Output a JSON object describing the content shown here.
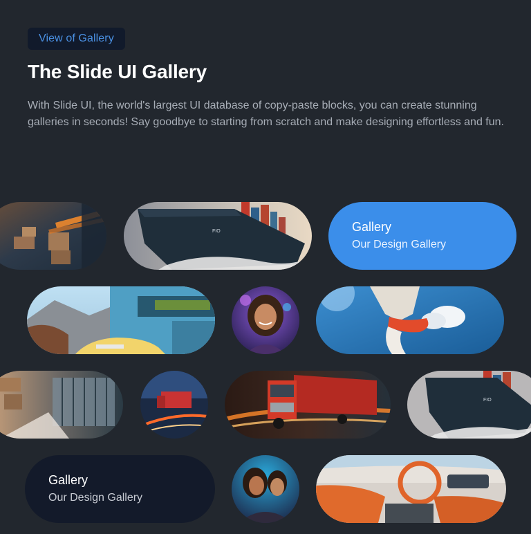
{
  "header": {
    "badge": "View of Gallery",
    "title": "The Slide UI Gallery",
    "description": "With Slide UI, the world's largest UI database of copy-paste blocks, you can create stunning galleries in seconds! Say goodbye to starting from scratch and make designing effortless and fun."
  },
  "gallery": {
    "cards": [
      {
        "title": "Gallery",
        "subtitle": "Our Design Gallery"
      },
      {
        "title": "Gallery",
        "subtitle": "Our Design Gallery"
      }
    ],
    "images": [
      "warehouse-motion-image",
      "cargo-ship-image",
      "modern-house-car-image",
      "woman-portrait-image",
      "athlete-jump-image",
      "warehouse-corridor-image",
      "truck-night-small-image",
      "red-truck-image",
      "cargo-ship-image-2",
      "couple-portrait-image",
      "car-interior-image"
    ]
  },
  "colors": {
    "background": "#22272e",
    "accent": "#3b8eea",
    "badge_bg": "#111a2b",
    "dark_card": "#131a2a"
  }
}
